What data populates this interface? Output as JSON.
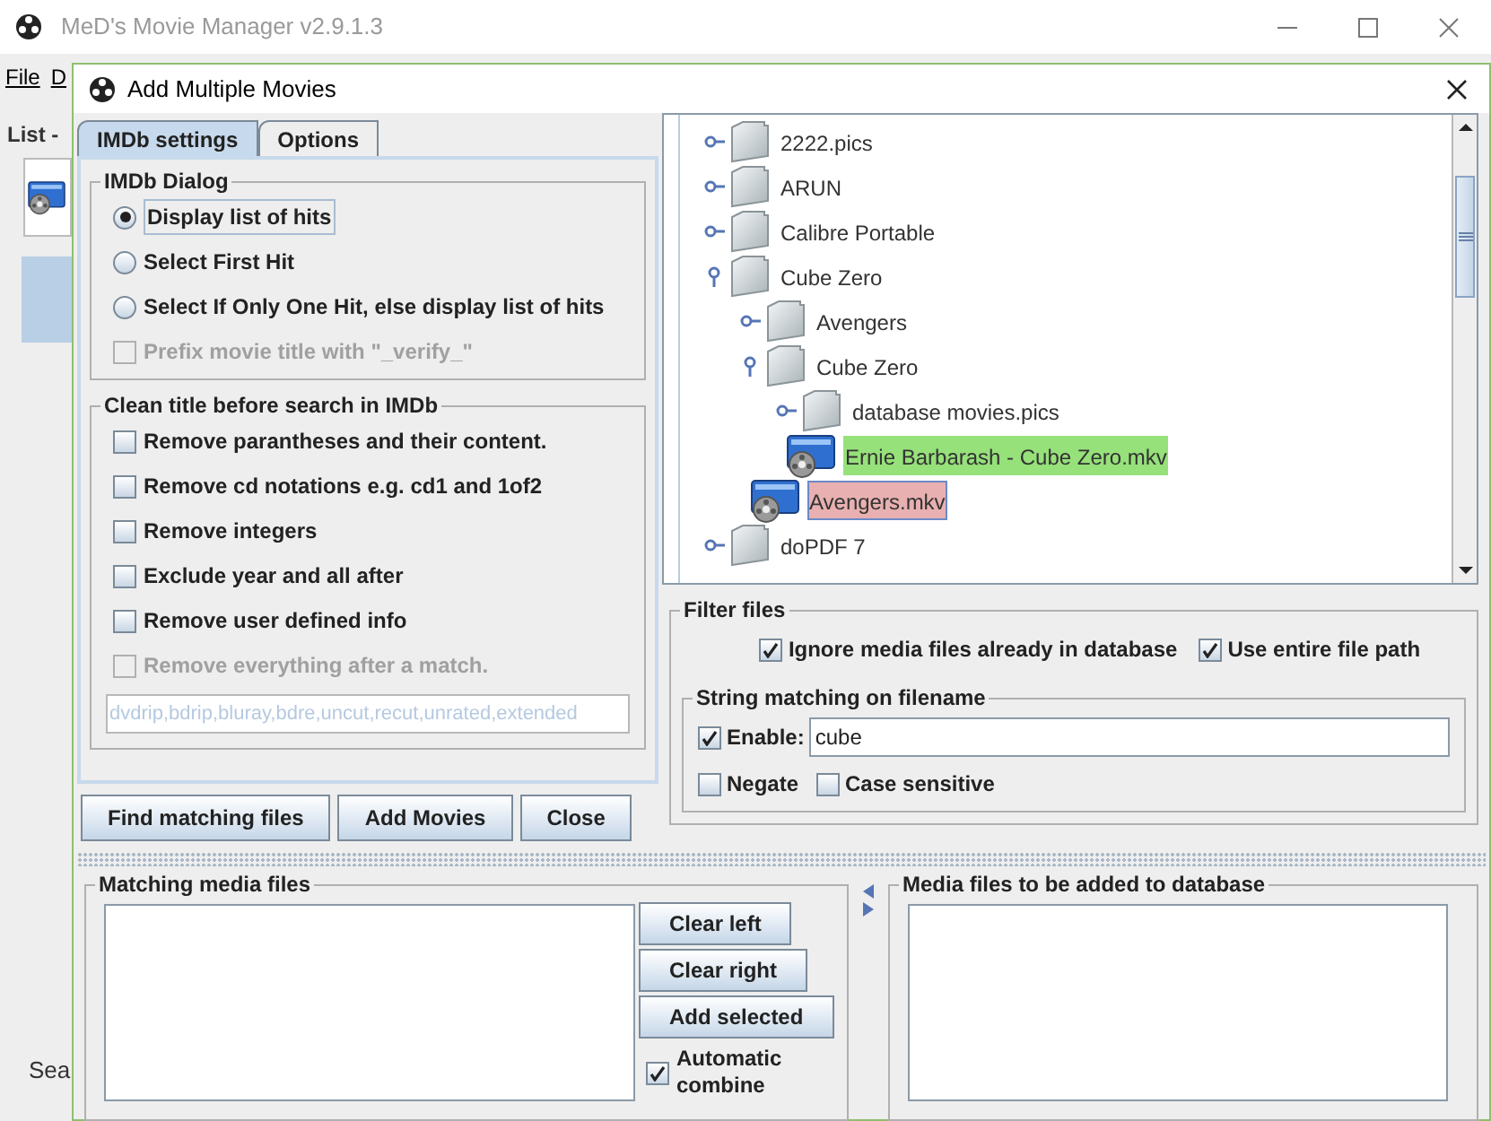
{
  "app_window": {
    "title": "MeD's Movie Manager v2.9.1.3",
    "menu": [
      "File",
      "D"
    ],
    "list_label": "List -",
    "search_label": "Sea"
  },
  "dialog": {
    "title": "Add Multiple Movies",
    "tabs": [
      {
        "label": "IMDb settings",
        "selected": true
      },
      {
        "label": "Options",
        "selected": false
      }
    ],
    "imdb_dialog": {
      "title": "IMDb Dialog",
      "options": [
        {
          "kind": "radio",
          "label": "Display list of hits",
          "checked": true,
          "disabled": false
        },
        {
          "kind": "radio",
          "label": "Select First Hit",
          "checked": false,
          "disabled": false
        },
        {
          "kind": "radio",
          "label": "Select If Only One Hit, else display list of hits",
          "checked": false,
          "disabled": false
        },
        {
          "kind": "checkbox",
          "label": "Prefix movie title with \"_verify_\"",
          "checked": false,
          "disabled": true
        }
      ]
    },
    "clean_title": {
      "title": "Clean title before search in IMDb",
      "options": [
        {
          "label": "Remove parantheses and their content.",
          "checked": false,
          "disabled": false
        },
        {
          "label": "Remove cd notations e.g. cd1 and 1of2",
          "checked": false,
          "disabled": false
        },
        {
          "label": "Remove integers",
          "checked": false,
          "disabled": false
        },
        {
          "label": "Exclude year and all after",
          "checked": false,
          "disabled": false
        },
        {
          "label": "Remove user defined info",
          "checked": false,
          "disabled": false
        },
        {
          "label": "Remove everything after a match.",
          "checked": false,
          "disabled": true
        }
      ],
      "user_info_field": {
        "value": "dvdrip,bdrip,bluray,bdre,uncut,recut,unrated,extended",
        "disabled": true
      }
    },
    "buttons": [
      "Find matching files",
      "Add Movies",
      "Close"
    ],
    "tree": [
      {
        "kind": "folder",
        "label": "2222.pics",
        "expanded": false,
        "selected": false
      },
      {
        "kind": "folder",
        "label": "ARUN",
        "expanded": false,
        "selected": false
      },
      {
        "kind": "folder",
        "label": "Calibre Portable",
        "expanded": false,
        "selected": false
      },
      {
        "kind": "folder",
        "label": "Cube Zero",
        "expanded": true,
        "selected": false,
        "children": [
          {
            "kind": "folder",
            "label": "Avengers",
            "expanded": false,
            "selected": false
          },
          {
            "kind": "folder",
            "label": "Cube Zero",
            "expanded": true,
            "selected": false,
            "children": [
              {
                "kind": "folder",
                "label": "database movies.pics",
                "expanded": false,
                "selected": false
              },
              {
                "kind": "file",
                "label": "Ernie Barbarash - Cube Zero.mkv",
                "selected": false,
                "color": "#96e17a"
              }
            ]
          },
          {
            "kind": "file",
            "label": "Avengers.mkv",
            "selected": true,
            "color": "#e8b0b0"
          }
        ]
      },
      {
        "kind": "folder",
        "label": "doPDF 7",
        "expanded": false,
        "selected": false
      }
    ],
    "filter": {
      "title": "Filter files",
      "options": [
        {
          "label": "Ignore media files already in database",
          "checked": true
        },
        {
          "label": "Use entire file path",
          "checked": true
        }
      ],
      "string_matching": {
        "title": "String matching on filename",
        "enable": {
          "label": "Enable:",
          "checked": true
        },
        "value": "cube",
        "options": [
          {
            "label": "Negate",
            "checked": false
          },
          {
            "label": "Case sensitive",
            "checked": false
          }
        ]
      }
    },
    "matching": {
      "title": "Matching media files",
      "buttons": [
        "Clear left",
        "Clear right",
        "Add selected"
      ],
      "automatic_combine": {
        "label": "Automatic combine",
        "checked": true
      }
    },
    "to_add": {
      "title": "Media files to be added to database"
    }
  }
}
